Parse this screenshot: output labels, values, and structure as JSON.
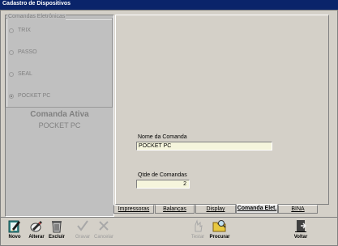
{
  "window": {
    "title": "Cadastro de Dispositivos"
  },
  "group": {
    "legend": "Comandas Eletrônicas",
    "options": [
      {
        "label": "TRIX",
        "selected": false
      },
      {
        "label": "PASSO",
        "selected": false
      },
      {
        "label": "SEAL",
        "selected": false
      },
      {
        "label": "POCKET PC",
        "selected": true
      }
    ]
  },
  "active": {
    "title": "Comanda Ativa",
    "value": "POCKET PC"
  },
  "form": {
    "nome_label": "Nome da Comanda",
    "nome_value": "POCKET PC",
    "qtde_label": "Qtde de Comandas",
    "qtde_value": "2"
  },
  "tabs": [
    "Impressoras",
    "Balanças",
    "Display",
    "Comanda Elet.",
    "BINA"
  ],
  "active_tab": "Comanda Elet.",
  "toolbar": {
    "novo": "Novo",
    "alterar": "Alterar",
    "excluir": "Excluir",
    "gravar": "Gravar",
    "cancelar": "Cancelar",
    "testar": "Testar",
    "procurar": "Procurar",
    "voltar": "Voltar"
  },
  "colors": {
    "titlebar": "#0a246a",
    "input_bg": "#f5f5dc",
    "window_bg": "#d4d0c8"
  }
}
